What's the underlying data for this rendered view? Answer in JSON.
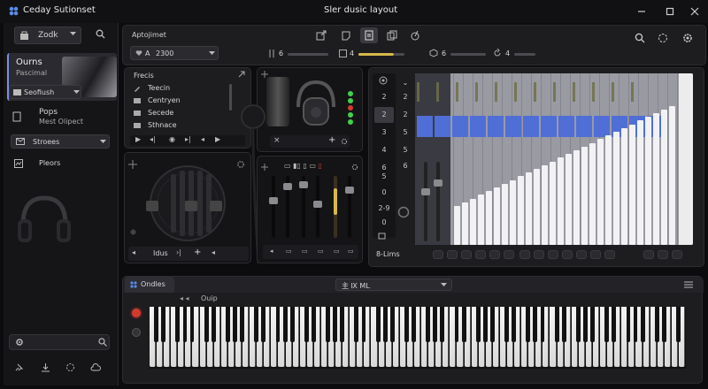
{
  "window": {
    "app_name": "Ceday Sutionset",
    "title": "Sler dusic layout"
  },
  "sidebar": {
    "selector_label": "Zodk",
    "card_title": "Ourns",
    "card_subtitle": "Pascimal",
    "dropdown_label": "Seofiush",
    "item_pops_title": "Pops",
    "item_pops_subtitle": "Mest Olipect",
    "item_stroees": "Stroees",
    "item_pleors": "Pleors"
  },
  "toolbar": {
    "section_label": "Aptojimet",
    "preset_prefix": "A",
    "preset_value": "2300",
    "meter1_value": "6",
    "meter2_value": "4",
    "meter3_value": "6",
    "meter4_value": "4"
  },
  "browser": {
    "title": "Frecis",
    "items": [
      "Teecin",
      "Centryen",
      "Secede",
      "Sthnace"
    ]
  },
  "speaker_panel": {
    "footer_label": "Idus"
  },
  "sequencer": {
    "row_numbers": [
      "2",
      "2",
      "3",
      "4",
      "6",
      "5",
      "0",
      "2-9",
      "0"
    ],
    "row_numbers_b": [
      "2",
      "2",
      "5",
      "5",
      "6"
    ],
    "footer_label": "8-Lims"
  },
  "keyboard_panel": {
    "tab_label": "Ondles",
    "preset_select": "主 Ⅸ ML",
    "sub_label": "Ouip"
  },
  "colors": {
    "accent_blue": "#4f6fd6",
    "accent_yellow": "#d7b84a",
    "led_green": "#3fd14a",
    "led_red": "#d23a30"
  }
}
